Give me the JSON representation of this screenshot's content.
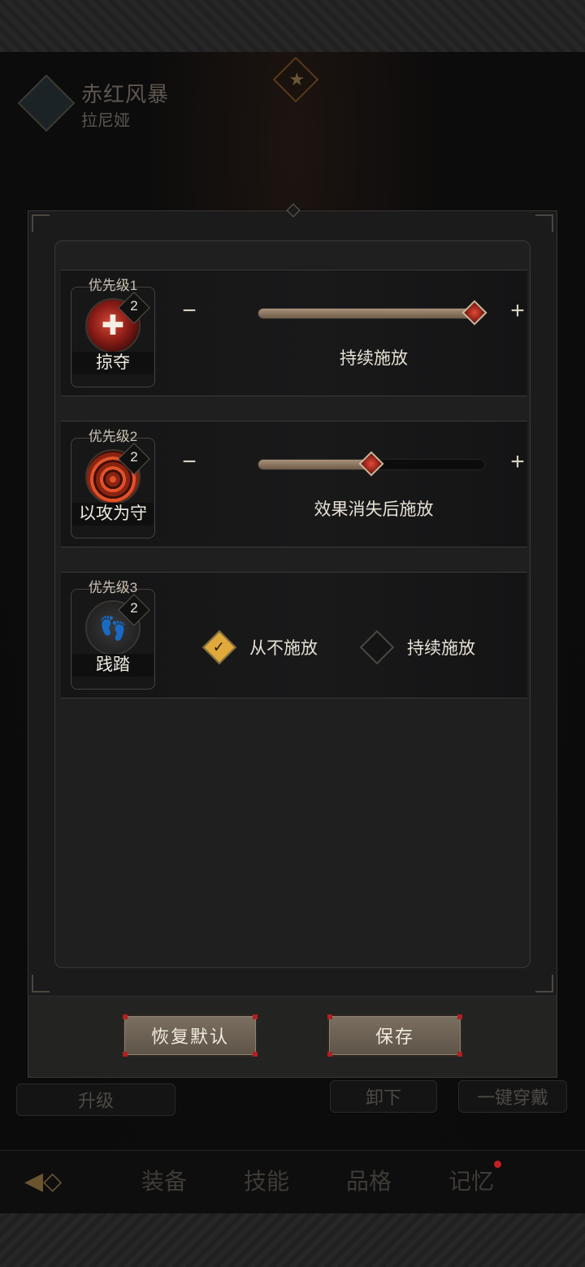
{
  "background": {
    "hero_title": "赤红风暴",
    "hero_subtitle": "拉尼娅",
    "upgrade_label": "升级",
    "unequip_label": "卸下",
    "equip_all_label": "一键穿戴",
    "nav_tabs": [
      "装备",
      "技能",
      "品格",
      "记忆"
    ]
  },
  "dialog": {
    "skills": [
      {
        "priority": "优先级1",
        "name": "掠夺",
        "level": "2",
        "icon": "plunder-icon",
        "control": "slider",
        "slider_fraction": 1.0,
        "mode": "持续施放"
      },
      {
        "priority": "优先级2",
        "name": "以攻为守",
        "level": "2",
        "icon": "offense-defense-icon",
        "control": "slider",
        "slider_fraction": 0.5,
        "mode": "效果消失后施放"
      },
      {
        "priority": "优先级3",
        "name": "践踏",
        "level": "2",
        "icon": "stomp-icon",
        "control": "options",
        "options": [
          "从不施放",
          "持续施放"
        ],
        "selected": 0
      }
    ],
    "reset_label": "恢复默认",
    "save_label": "保存"
  },
  "colors": {
    "accent_gold": "#e0a93a",
    "slider_fill": "#a8927a",
    "thumb_red": "#e24a3a"
  }
}
